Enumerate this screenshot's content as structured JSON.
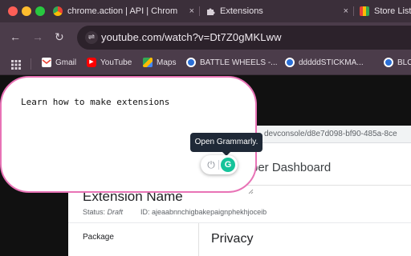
{
  "colors": {
    "tabstrip_bg": "#3b2f3a",
    "toolbar_bg": "#4b3c4a",
    "popup_border": "#e873b6",
    "grammarly_green": "#15c39a",
    "traffic_close": "#fe5f57",
    "traffic_min": "#febc2e",
    "traffic_max": "#28c840"
  },
  "tabs": [
    {
      "label": "chrome.action | API | Chrom",
      "icon": "chrome-icon",
      "close": "×"
    },
    {
      "label": "Extensions",
      "icon": "puzzle-icon",
      "close": "×"
    },
    {
      "label": "Store List",
      "icon": "webstore-icon"
    }
  ],
  "nav": {
    "back": "←",
    "forward": "→",
    "reload": "↻",
    "site_info": "⇌"
  },
  "omnibox": {
    "url": "youtube.com/watch?v=Dt7Z0gMKLww"
  },
  "bookmarks": [
    {
      "label": "Gmail",
      "icon": "gmail-icon"
    },
    {
      "label": "YouTube",
      "icon": "youtube-icon"
    },
    {
      "label": "Maps",
      "icon": "maps-icon"
    },
    {
      "label": "BATTLE WHEELS -...",
      "icon": "site-icon"
    },
    {
      "label": "dddddSTICKMA...",
      "icon": "site-icon"
    },
    {
      "label": "BLO",
      "icon": "site-icon"
    }
  ],
  "popup": {
    "text": "Learn how to make extensions"
  },
  "grammarly": {
    "tooltip": "Open Grammarly.",
    "logo": "G",
    "power": "⏻"
  },
  "devconsole": {
    "url": "devconsole/d8e7d098-bf90-485a-8ce",
    "title": "per Dashboard",
    "extension_name": "Extension Name",
    "status_label": "Status:",
    "status_value": "Draft",
    "id_text": "ID: ajeaabnnchigbakepaignphekhjoceib",
    "package_label": "Package",
    "privacy_heading": "Privacy"
  }
}
